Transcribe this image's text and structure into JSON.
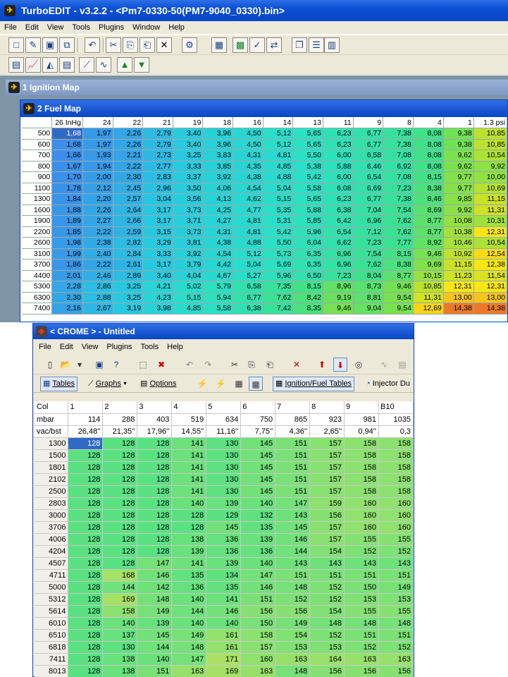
{
  "turboedit": {
    "title": "TurboEDIT - v3.2.2  -  <Pm7-0330-50(PM7-9040_0330).bin>",
    "menu": [
      "File",
      "Edit",
      "View",
      "Tools",
      "Plugins",
      "Window",
      "Help"
    ],
    "ign_title": "1 Ignition Map",
    "fuel_title": "2 Fuel Map",
    "fuel_cols": [
      "26 InHg",
      "24",
      "22",
      "21",
      "19",
      "18",
      "16",
      "14",
      "13",
      "11",
      "9",
      "8",
      "4",
      "1",
      "1.3 psi"
    ],
    "fuel_rows": [
      {
        "rpm": "500",
        "v": [
          "1,68",
          "1,97",
          "2,26",
          "2,79",
          "3,40",
          "3,96",
          "4,50",
          "5,12",
          "5,65",
          "6,23",
          "6,77",
          "7,38",
          "8,08",
          "9,38",
          "10,85"
        ]
      },
      {
        "rpm": "600",
        "v": [
          "1,68",
          "1,97",
          "2,26",
          "2,79",
          "3,40",
          "3,96",
          "4,50",
          "5,12",
          "5,65",
          "6,23",
          "6,77",
          "7,38",
          "8,08",
          "9,38",
          "10,85"
        ]
      },
      {
        "rpm": "700",
        "v": [
          "1,66",
          "1,93",
          "2,21",
          "2,73",
          "3,25",
          "3,83",
          "4,31",
          "4,81",
          "5,50",
          "6,00",
          "6,58",
          "7,08",
          "8,08",
          "9,62",
          "10,54"
        ]
      },
      {
        "rpm": "800",
        "v": [
          "1,67",
          "1,94",
          "2,22",
          "2,77",
          "3,33",
          "3,85",
          "4,35",
          "4,85",
          "5,38",
          "5,88",
          "6,46",
          "6,92",
          "8,08",
          "9,62",
          "9,92"
        ]
      },
      {
        "rpm": "900",
        "v": [
          "1,70",
          "2,00",
          "2,30",
          "2,83",
          "3,37",
          "3,92",
          "4,38",
          "4,88",
          "5,42",
          "6,00",
          "6,54",
          "7,08",
          "8,15",
          "9,77",
          "10,00"
        ]
      },
      {
        "rpm": "1100",
        "v": [
          "1,78",
          "2,12",
          "2,45",
          "2,96",
          "3,50",
          "4,06",
          "4,54",
          "5,04",
          "5,58",
          "6,08",
          "6,69",
          "7,23",
          "8,38",
          "9,77",
          "10,69"
        ]
      },
      {
        "rpm": "1300",
        "v": [
          "1,84",
          "2,20",
          "2,57",
          "3,04",
          "3,56",
          "4,13",
          "4,62",
          "5,15",
          "5,65",
          "6,23",
          "6,77",
          "7,38",
          "8,46",
          "9,85",
          "11,15"
        ]
      },
      {
        "rpm": "1600",
        "v": [
          "1,88",
          "2,26",
          "2,64",
          "3,17",
          "3,73",
          "4,25",
          "4,77",
          "5,35",
          "5,88",
          "6,38",
          "7,04",
          "7,54",
          "8,69",
          "9,92",
          "11,31"
        ]
      },
      {
        "rpm": "1900",
        "v": [
          "1,89",
          "2,27",
          "2,66",
          "3,17",
          "3,71",
          "4,27",
          "4,81",
          "5,31",
          "5,85",
          "6,42",
          "6,96",
          "7,62",
          "8,77",
          "10,08",
          "10,31"
        ]
      },
      {
        "rpm": "2200",
        "v": [
          "1,85",
          "2,22",
          "2,59",
          "3,15",
          "3,73",
          "4,31",
          "4,81",
          "5,42",
          "5,96",
          "6,54",
          "7,12",
          "7,62",
          "8,77",
          "10,38",
          "12,31"
        ]
      },
      {
        "rpm": "2600",
        "v": [
          "1,98",
          "2,38",
          "2,82",
          "3,29",
          "3,81",
          "4,38",
          "4,88",
          "5,50",
          "6,04",
          "6,62",
          "7,23",
          "7,77",
          "8,92",
          "10,46",
          "10,54"
        ]
      },
      {
        "rpm": "3100",
        "v": [
          "1,99",
          "2,40",
          "2,84",
          "3,33",
          "3,92",
          "4,54",
          "5,12",
          "5,73",
          "6,35",
          "6,96",
          "7,54",
          "8,15",
          "9,46",
          "10,92",
          "12,54"
        ]
      },
      {
        "rpm": "3700",
        "v": [
          "1,86",
          "2,22",
          "2,61",
          "3,17",
          "3,79",
          "4,42",
          "5,04",
          "5,69",
          "6,35",
          "6,96",
          "7,62",
          "8,38",
          "9,69",
          "11,15",
          "12,38"
        ]
      },
      {
        "rpm": "4400",
        "v": [
          "2,01",
          "2,46",
          "2,89",
          "3,40",
          "4,04",
          "4,67",
          "5,27",
          "5,96",
          "6,50",
          "7,23",
          "8,04",
          "8,77",
          "10,15",
          "11,23",
          "11,54"
        ]
      },
      {
        "rpm": "5300",
        "v": [
          "2,28",
          "2,86",
          "3,25",
          "4,21",
          "5,02",
          "5,79",
          "6,58",
          "7,35",
          "8,15",
          "8,96",
          "8,73",
          "9,46",
          "10,85",
          "12,31",
          "12,31"
        ]
      },
      {
        "rpm": "6300",
        "v": [
          "2,30",
          "2,88",
          "3,25",
          "4,23",
          "5,15",
          "5,94",
          "6,77",
          "7,62",
          "8,42",
          "9,19",
          "8,81",
          "9,54",
          "11,31",
          "13,00",
          "13,00"
        ]
      },
      {
        "rpm": "7400",
        "v": [
          "2,16",
          "2,67",
          "3,19",
          "3,98",
          "4,85",
          "5,58",
          "6,38",
          "7,42",
          "8,35",
          "9,46",
          "9,04",
          "9,54",
          "12,69",
          "14,38",
          "14,38"
        ]
      }
    ]
  },
  "crome": {
    "title": "< CROME > - Untitled",
    "menu": [
      "File",
      "Edit",
      "View",
      "Plugins",
      "Tools",
      "Help"
    ],
    "tabs": {
      "tables": "Tables",
      "graphs": "Graphs",
      "options": "Options",
      "ign_fuel": "Ignition/Fuel Tables",
      "injector": "Injector Du"
    },
    "header_rows": [
      {
        "label": "Col",
        "v": [
          "1",
          "2",
          "3",
          "4",
          "5",
          "6",
          "7",
          "8",
          "9",
          "B10"
        ]
      },
      {
        "label": "mbar",
        "v": [
          "114",
          "288",
          "403",
          "519",
          "634",
          "750",
          "865",
          "923",
          "981",
          "1035"
        ]
      },
      {
        "label": "vac/bst",
        "v": [
          "26,48''",
          "21,35''",
          "17,96''",
          "14,55''",
          "11,16''",
          "7,75''",
          "4,36''",
          "2,65''",
          "0,94''",
          "0,3"
        ]
      }
    ],
    "rows": [
      {
        "rpm": "1300",
        "v": [
          "128",
          "128",
          "128",
          "141",
          "130",
          "145",
          "151",
          "157",
          "158",
          "158"
        ]
      },
      {
        "rpm": "1500",
        "v": [
          "128",
          "128",
          "128",
          "141",
          "130",
          "145",
          "151",
          "157",
          "158",
          "158"
        ]
      },
      {
        "rpm": "1801",
        "v": [
          "128",
          "128",
          "128",
          "141",
          "130",
          "145",
          "151",
          "157",
          "158",
          "158"
        ]
      },
      {
        "rpm": "2102",
        "v": [
          "128",
          "128",
          "128",
          "141",
          "130",
          "145",
          "151",
          "157",
          "158",
          "158"
        ]
      },
      {
        "rpm": "2500",
        "v": [
          "128",
          "128",
          "128",
          "141",
          "130",
          "145",
          "151",
          "157",
          "158",
          "158"
        ]
      },
      {
        "rpm": "2803",
        "v": [
          "128",
          "128",
          "128",
          "140",
          "139",
          "140",
          "147",
          "159",
          "160",
          "160"
        ]
      },
      {
        "rpm": "3000",
        "v": [
          "128",
          "128",
          "128",
          "128",
          "129",
          "132",
          "143",
          "156",
          "160",
          "160"
        ]
      },
      {
        "rpm": "3706",
        "v": [
          "128",
          "128",
          "128",
          "128",
          "145",
          "135",
          "145",
          "157",
          "160",
          "160"
        ]
      },
      {
        "rpm": "4006",
        "v": [
          "128",
          "128",
          "128",
          "138",
          "136",
          "139",
          "146",
          "157",
          "155",
          "155"
        ]
      },
      {
        "rpm": "4204",
        "v": [
          "128",
          "128",
          "128",
          "139",
          "136",
          "136",
          "144",
          "154",
          "152",
          "152"
        ]
      },
      {
        "rpm": "4507",
        "v": [
          "128",
          "128",
          "147",
          "141",
          "139",
          "140",
          "143",
          "143",
          "143",
          "143"
        ]
      },
      {
        "rpm": "4711",
        "v": [
          "128",
          "168",
          "146",
          "135",
          "134",
          "147",
          "151",
          "151",
          "151",
          "151"
        ]
      },
      {
        "rpm": "5000",
        "v": [
          "128",
          "144",
          "142",
          "136",
          "135",
          "146",
          "148",
          "152",
          "150",
          "149"
        ]
      },
      {
        "rpm": "5312",
        "v": [
          "128",
          "169",
          "148",
          "140",
          "141",
          "151",
          "152",
          "152",
          "153",
          "153"
        ]
      },
      {
        "rpm": "5614",
        "v": [
          "128",
          "158",
          "149",
          "144",
          "146",
          "156",
          "156",
          "154",
          "155",
          "155"
        ]
      },
      {
        "rpm": "6010",
        "v": [
          "128",
          "140",
          "139",
          "140",
          "140",
          "150",
          "149",
          "148",
          "148",
          "148"
        ]
      },
      {
        "rpm": "6510",
        "v": [
          "128",
          "137",
          "145",
          "149",
          "161",
          "158",
          "154",
          "152",
          "151",
          "151"
        ]
      },
      {
        "rpm": "6818",
        "v": [
          "128",
          "130",
          "144",
          "148",
          "161",
          "157",
          "153",
          "153",
          "152",
          "152"
        ]
      },
      {
        "rpm": "7411",
        "v": [
          "128",
          "138",
          "140",
          "147",
          "171",
          "160",
          "163",
          "164",
          "163",
          "163"
        ]
      },
      {
        "rpm": "8013",
        "v": [
          "128",
          "138",
          "151",
          "163",
          "169",
          "163",
          "148",
          "156",
          "156",
          "156"
        ]
      }
    ]
  }
}
